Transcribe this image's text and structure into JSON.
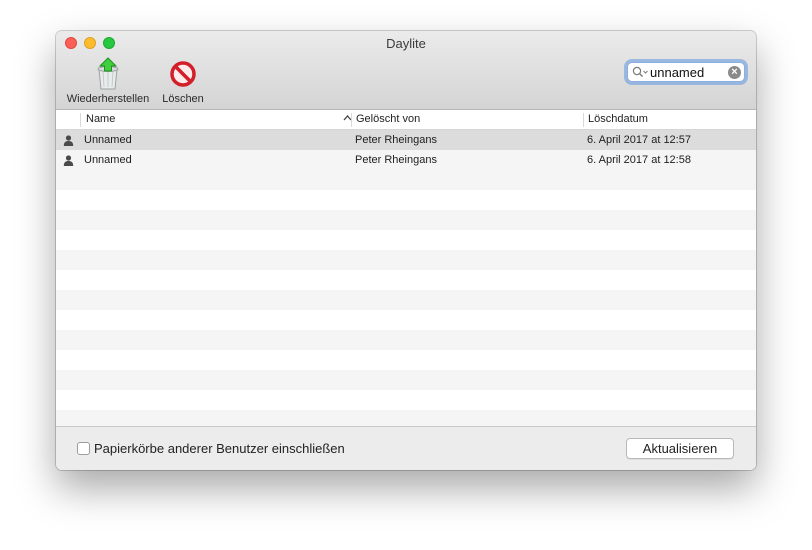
{
  "window": {
    "title": "Daylite"
  },
  "toolbar": {
    "restore_label": "Wiederherstellen",
    "delete_label": "Löschen"
  },
  "search": {
    "value": "unnamed",
    "clear_icon": "clear-icon"
  },
  "table": {
    "columns": [
      "Name",
      "Gelöscht von",
      "Löschdatum"
    ],
    "sort_icon": "chevron-up-icon",
    "rows": [
      {
        "icon": "person-icon",
        "name": "Unnamed",
        "deleted_by": "Peter Rheingans",
        "date": "6. April 2017 at 12:57",
        "selected": true
      },
      {
        "icon": "person-icon",
        "name": "Unnamed",
        "deleted_by": "Peter Rheingans",
        "date": "6. April 2017 at 12:58",
        "selected": false
      }
    ]
  },
  "footer": {
    "include_label": "Papierkörbe anderer Benutzer einschließen",
    "include_checked": false,
    "refresh_label": "Aktualisieren"
  },
  "colors": {
    "selected_row": "#dcdcdc",
    "stripe": "#f5f5f5",
    "search_focus": "#5e96de"
  }
}
